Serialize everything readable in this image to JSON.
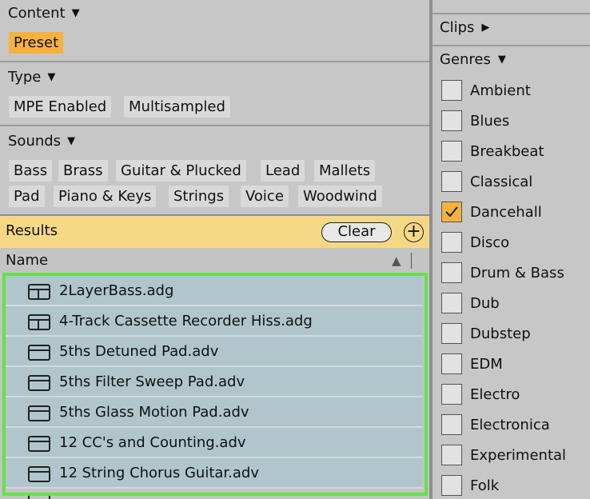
{
  "content": {
    "title": "Content",
    "tags": [
      {
        "label": "Preset",
        "active": true
      }
    ]
  },
  "type": {
    "title": "Type",
    "tags": [
      "MPE Enabled",
      "Multisampled"
    ]
  },
  "sounds": {
    "title": "Sounds",
    "tags": [
      "Bass",
      "Brass",
      "Guitar & Plucked",
      "Lead",
      "Mallets",
      "Pad",
      "Piano & Keys",
      "Strings",
      "Voice",
      "Woodwind"
    ]
  },
  "results": {
    "label": "Results",
    "clear_label": "Clear",
    "add_label": "+"
  },
  "columns": {
    "name": "Name",
    "sort_indicator": "▲"
  },
  "files": [
    {
      "name": "2LayerBass.adg",
      "icon": "rack-icon"
    },
    {
      "name": "4-Track Cassette Recorder Hiss.adg",
      "icon": "rack-icon"
    },
    {
      "name": "5ths Detuned Pad.adv",
      "icon": "preset-icon"
    },
    {
      "name": "5ths Filter Sweep Pad.adv",
      "icon": "preset-icon"
    },
    {
      "name": "5ths Glass Motion Pad.adv",
      "icon": "preset-icon"
    },
    {
      "name": "12 CC's and Counting.adv",
      "icon": "preset-icon"
    },
    {
      "name": "12 String Chorus Guitar.adv",
      "icon": "preset-icon"
    },
    {
      "name": "",
      "icon": "preset-icon"
    }
  ],
  "right_panel": {
    "clips_label": "Clips",
    "genres_label": "Genres",
    "genres": [
      {
        "label": "Ambient",
        "checked": false
      },
      {
        "label": "Blues",
        "checked": false
      },
      {
        "label": "Breakbeat",
        "checked": false
      },
      {
        "label": "Classical",
        "checked": false
      },
      {
        "label": "Dancehall",
        "checked": true
      },
      {
        "label": "Disco",
        "checked": false
      },
      {
        "label": "Drum & Bass",
        "checked": false
      },
      {
        "label": "Dub",
        "checked": false
      },
      {
        "label": "Dubstep",
        "checked": false
      },
      {
        "label": "EDM",
        "checked": false
      },
      {
        "label": "Electro",
        "checked": false
      },
      {
        "label": "Electronica",
        "checked": false
      },
      {
        "label": "Experimental",
        "checked": false
      },
      {
        "label": "Folk",
        "checked": false
      }
    ]
  },
  "colors": {
    "active_tag": "#f6b23d",
    "results_bar": "#f5d885",
    "row_bg": "#b0c6cc",
    "selection_outline": "#64e24a"
  }
}
